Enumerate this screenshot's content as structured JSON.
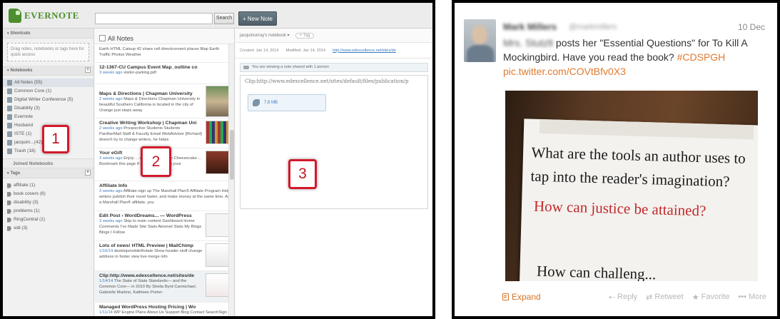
{
  "evernote": {
    "logo": "EVERNOTE",
    "search_button": "Search",
    "new_note": "+ New Note",
    "sidebar": {
      "shortcuts_header": "Shortcuts",
      "shortcuts_hint": "Drag notes, notebooks or tags here for quick access",
      "notebooks_header": "Notebooks",
      "notebooks": [
        {
          "label": "All Notes (55)"
        },
        {
          "label": "Common Core (1)"
        },
        {
          "label": "Digital Writer Conference (5)"
        },
        {
          "label": "Disability (3)"
        },
        {
          "label": "Evernote"
        },
        {
          "label": "Husband"
        },
        {
          "label": "ISTE (1)"
        },
        {
          "label": "jacquim...(42)"
        },
        {
          "label": "Trash (18)"
        }
      ],
      "joined_header": "Joined Notebooks",
      "tags_header": "Tags",
      "tags": [
        {
          "label": "affiliate (1)"
        },
        {
          "label": "book covers (6)"
        },
        {
          "label": "disability (3)"
        },
        {
          "label": "problems (1)"
        },
        {
          "label": "RingCentral (1)"
        },
        {
          "label": "sidi (3)"
        }
      ]
    },
    "note_list": {
      "header": "All Notes",
      "notes": [
        {
          "title": "",
          "date": "",
          "snippet": "Earth HTML Catsup 42 share cell directconnect places Map Earth Traffic Photos Weather"
        },
        {
          "title": "12-1367-CU Campus Event Map_outline co",
          "date": "3 weeks ago",
          "snippet": "visitor-parking.pdf"
        },
        {
          "title": "Maps & Directions | Chapman University",
          "date": "2 weeks ago",
          "snippet": "Maps & Directions Chapman University in beautiful Southern California is located in the city of Orange just steps away"
        },
        {
          "title": "Creative Writing Workshop | Chapman Uni",
          "date": "2 weeks ago",
          "snippet": "Prospective Students Students PantherMail Staff & Faculty Email WebAdvisor [Richard] doesn't try to change writers, he helps"
        },
        {
          "title": "Your eGift",
          "date": "3 weeks ago",
          "snippet": "Enjoy ... eGift Card for The Cheesecake ... Bookmark this page if you aren't ... eem your"
        },
        {
          "title": "Affiliate Info",
          "date": "3 weeks ago",
          "snippet": "Affiliate-sign up The Marshall Plan® Affiliate Program Help writers publish their novel faster, and make money at the same time. As a Marshall Plan® affiliate, you"
        },
        {
          "title": "Edit Post ‹ WordDreams... — WordPress",
          "date": "3 weeks ago",
          "snippet": "Skip to main content Dashboard Home Comments I've Made Site Stats Akismet Stats My Blogs Blogs I Follow"
        },
        {
          "title": "Lots of news! HTML Preview | MailChimp",
          "date": "1/16/14",
          "snippet": "desktopmobileRotate Show header stuff change address in footer view live merge info"
        },
        {
          "title": "Clip:http://www.edexcellence.net/sites/de",
          "date": "1/14/14",
          "snippet": "The State of State Standards— and the Common Core— in 2010 By Sheila Byrd Carmichael, Gabrielle Martino, Kathleen Porter-"
        },
        {
          "title": "Managed WordPress Hosting Pricing | Wo",
          "date": "1/11/14",
          "snippet": "WP Engine Plans About Us Support Blog Contact SearchSign In Feedback Twitter RSS Google+ Plans & Pricing Try Us Risk Free"
        }
      ]
    },
    "editor": {
      "notebook": "jacquimurray's notebook ▾",
      "tag_button": "+ Tag",
      "created": "Created: Jan 14, 2014",
      "modified": "Modified: Jan 14, 2014",
      "source_url": "http://www.edexcellence.net/sites/de",
      "share_notice": "You are viewing a note shared with 1 person",
      "clip_text": "Clip:http://www.edexcellence.net/sites/default/files/publication/p",
      "attachment_size": "7.8 MB"
    },
    "callouts": [
      "1",
      "2",
      "3"
    ],
    "colors": {
      "callout": "#d4182b",
      "logo": "#4d8f2e"
    }
  },
  "tweet": {
    "author_name": "Mark Millers",
    "author_handle": "@markmillers",
    "date": "10 Dec",
    "mention": "Mrs. Stutzlt",
    "text_main": " posts her \"Essential Questions\" for To Kill A Mockingbird. Have you read the book? ",
    "hashtag": "#CDSPGH",
    "link": "pic.twitter.com/COVtBfv0X3",
    "photo": {
      "line1": "What are the tools an author uses to tap into the reader's imagination?",
      "line2": "How can justice be attained?",
      "line3": "How can challeng..."
    },
    "expand": "Expand",
    "reply": "Reply",
    "retweet": "Retweet",
    "favorite": "Favorite",
    "more": "More",
    "colors": {
      "link": "#e07a2f",
      "question_red": "#c2282c"
    }
  }
}
